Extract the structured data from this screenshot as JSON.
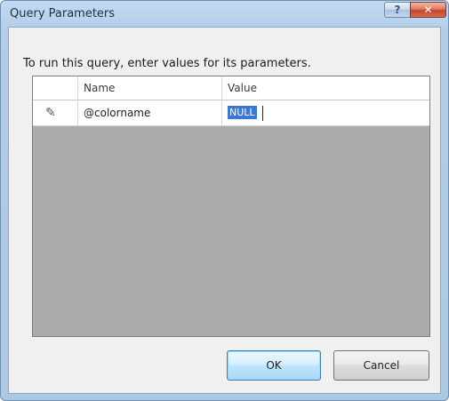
{
  "window": {
    "title": "Query Parameters",
    "help_glyph": "?",
    "close_glyph": "✕"
  },
  "dialog": {
    "instruction": "To run this query, enter values for its parameters."
  },
  "grid": {
    "columns": [
      "",
      "Name",
      "Value"
    ],
    "rows": [
      {
        "row_icon": "pencil-icon",
        "row_glyph": "✎",
        "name": "@colorname",
        "value": "NULL"
      }
    ]
  },
  "buttons": {
    "ok": "OK",
    "cancel": "Cancel"
  }
}
